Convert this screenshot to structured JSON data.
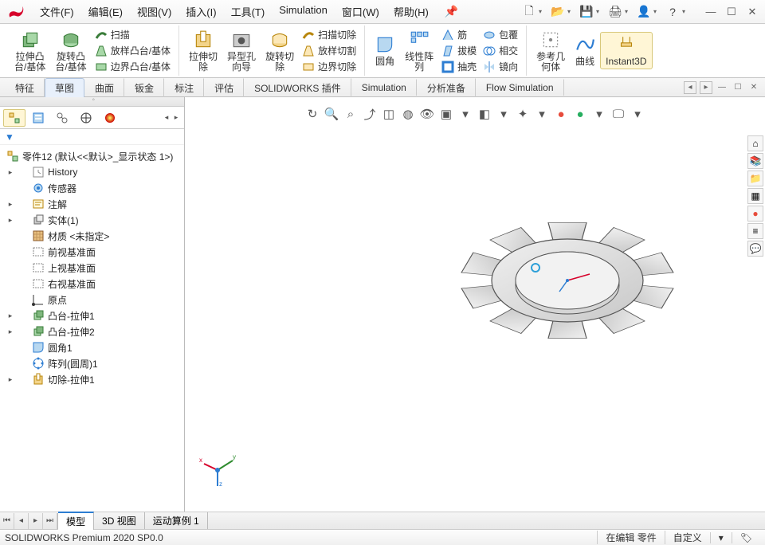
{
  "menus": [
    "文件(F)",
    "编辑(E)",
    "视图(V)",
    "插入(I)",
    "工具(T)",
    "Simulation",
    "窗口(W)",
    "帮助(H)"
  ],
  "ribbon": {
    "g1_big1": "拉伸凸\n台/基体",
    "g1_big2": "旋转凸\n台/基体",
    "g1_s": [
      "扫描",
      "放样凸台/基体",
      "边界凸台/基体"
    ],
    "g2_big1": "拉伸切\n除",
    "g2_big2": "异型孔\n向导",
    "g2_big3": "旋转切\n除",
    "g2_s": [
      "扫描切除",
      "放样切割",
      "边界切除"
    ],
    "g3_big1": "圆角",
    "g3_big2": "线性阵\n列",
    "g3_s": [
      "筋",
      "拔模",
      "抽壳"
    ],
    "g3_s2": [
      "包覆",
      "相交",
      "镜向"
    ],
    "g4_big1": "参考几\n何体",
    "g4_big2": "曲线",
    "g4_big3": "Instant3D"
  },
  "tabs": [
    "特征",
    "草图",
    "曲面",
    "钣金",
    "标注",
    "评估",
    "SOLIDWORKS 插件",
    "Simulation",
    "分析准备",
    "Flow Simulation"
  ],
  "tree": {
    "root": "零件12  (默认<<默认>_显示状态 1>)",
    "items": [
      {
        "label": "History",
        "expand": true
      },
      {
        "label": "传感器"
      },
      {
        "label": "注解",
        "expand": true
      },
      {
        "label": "实体(1)",
        "expand": true
      },
      {
        "label": "材质 <未指定>"
      },
      {
        "label": "前视基准面"
      },
      {
        "label": "上视基准面"
      },
      {
        "label": "右视基准面"
      },
      {
        "label": "原点"
      },
      {
        "label": "凸台-拉伸1",
        "expand": true
      },
      {
        "label": "凸台-拉伸2",
        "expand": true
      },
      {
        "label": "圆角1"
      },
      {
        "label": "阵列(圆周)1"
      },
      {
        "label": "切除-拉伸1",
        "expand": true
      }
    ]
  },
  "bottom_tabs": [
    "模型",
    "3D 视图",
    "运动算例 1"
  ],
  "status": {
    "left": "SOLIDWORKS Premium 2020 SP0.0",
    "right1": "在编辑 零件",
    "right2": "自定义"
  }
}
